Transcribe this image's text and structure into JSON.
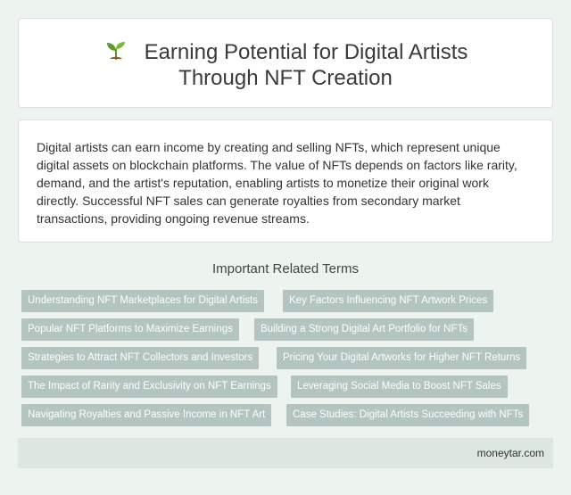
{
  "header": {
    "icon": "sprout-icon",
    "title": "Earning Potential for Digital Artists Through NFT Creation"
  },
  "description": "Digital artists can earn income by creating and selling NFTs, which represent unique digital assets on blockchain platforms. The value of NFTs depends on factors like rarity, demand, and the artist's reputation, enabling artists to monetize their original work directly. Successful NFT sales can generate royalties from secondary market transactions, providing ongoing revenue streams.",
  "related": {
    "heading": "Important Related Terms",
    "tags": [
      "Understanding NFT Marketplaces for Digital Artists",
      "Key Factors Influencing NFT Artwork Prices",
      "Popular NFT Platforms to Maximize Earnings",
      "Building a Strong Digital Art Portfolio for NFTs",
      "Strategies to Attract NFT Collectors and Investors",
      "Pricing Your Digital Artworks for Higher NFT Returns",
      "The Impact of Rarity and Exclusivity on NFT Earnings",
      "Leveraging Social Media to Boost NFT Sales",
      "Navigating Royalties and Passive Income in NFT Art",
      "Case Studies: Digital Artists Succeeding with NFTs"
    ]
  },
  "footer": {
    "site": "moneytar.com"
  },
  "colors": {
    "background": "#edf4ef",
    "tag_bg": "#b3c4c1",
    "footer_bg": "#dde7e1"
  }
}
